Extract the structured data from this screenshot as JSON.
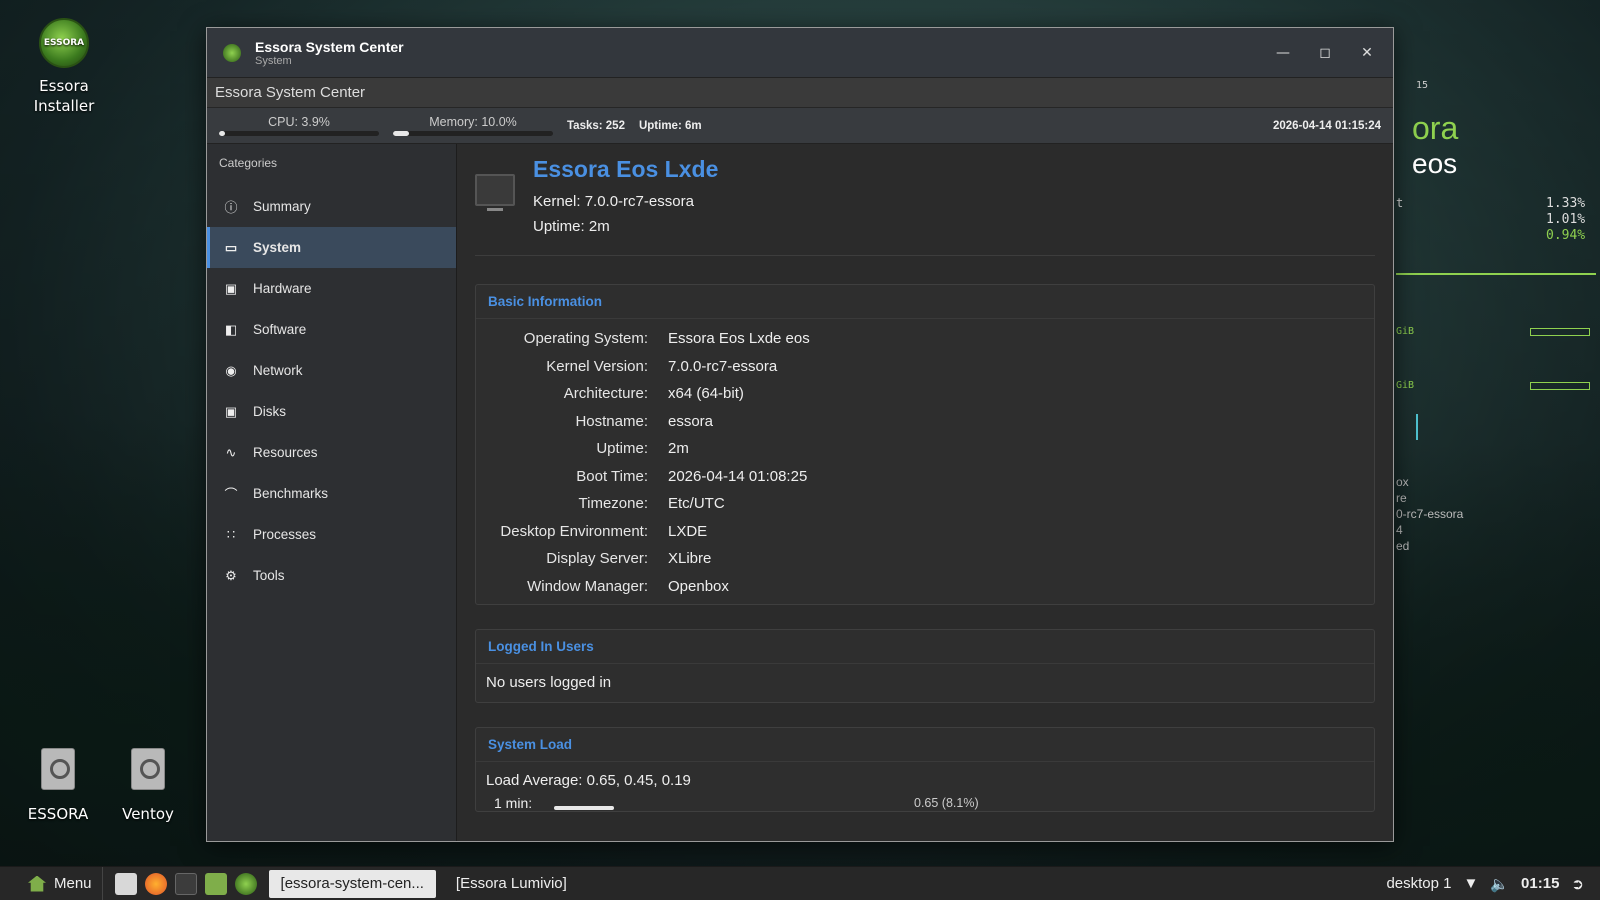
{
  "desktop": {
    "icons": [
      {
        "label_line1": "Essora",
        "label_line2": "Installer"
      },
      {
        "label": "ESSORA"
      },
      {
        "label": "Ventoy"
      }
    ],
    "conky": {
      "brand": "ora",
      "edition": "eos",
      "loads": [
        "1.33%",
        "1.01%",
        "0.94%"
      ],
      "gib1": "GiB",
      "gib2": "GiB",
      "lines": [
        "ox",
        "re",
        "0-rc7-essora",
        "4",
        "ed"
      ],
      "tiny": "15",
      "t_label": "t"
    }
  },
  "window": {
    "title": "Essora System Center",
    "subtitle": "System",
    "app_header": "Essora System Center",
    "status": {
      "cpu_label": "CPU: 3.9%",
      "cpu_fraction": 0.039,
      "mem_label": "Memory: 10.0%",
      "mem_fraction": 0.1,
      "tasks": "Tasks: 252",
      "uptime": "Uptime: 6m",
      "clock": "2026-04-14 01:15:24"
    },
    "sidebar": {
      "heading": "Categories",
      "items": [
        {
          "label": "Summary",
          "icon": "info-icon"
        },
        {
          "label": "System",
          "icon": "monitor-icon"
        },
        {
          "label": "Hardware",
          "icon": "chip-icon"
        },
        {
          "label": "Software",
          "icon": "software-icon"
        },
        {
          "label": "Network",
          "icon": "globe-icon"
        },
        {
          "label": "Disks",
          "icon": "disk-icon"
        },
        {
          "label": "Resources",
          "icon": "pulse-icon"
        },
        {
          "label": "Benchmarks",
          "icon": "speedometer-icon"
        },
        {
          "label": "Processes",
          "icon": "processes-icon"
        },
        {
          "label": "Tools",
          "icon": "gear-icon"
        }
      ]
    },
    "hero": {
      "name": "Essora Eos Lxde",
      "kernel": "Kernel: 7.0.0-rc7-essora",
      "uptime": "Uptime: 2m"
    },
    "basic": {
      "title": "Basic Information",
      "rows": [
        {
          "k": "Operating System:",
          "v": "Essora Eos Lxde eos"
        },
        {
          "k": "Kernel Version:",
          "v": "7.0.0-rc7-essora"
        },
        {
          "k": "Architecture:",
          "v": "x64 (64-bit)"
        },
        {
          "k": "Hostname:",
          "v": "essora"
        },
        {
          "k": "Uptime:",
          "v": "2m"
        },
        {
          "k": "Boot Time:",
          "v": "2026-04-14 01:08:25"
        },
        {
          "k": "Timezone:",
          "v": "Etc/UTC"
        },
        {
          "k": "Desktop Environment:",
          "v": "LXDE"
        },
        {
          "k": "Display Server:",
          "v": "XLibre"
        },
        {
          "k": "Window Manager:",
          "v": "Openbox"
        }
      ]
    },
    "users": {
      "title": "Logged In Users",
      "text": "No users logged in"
    },
    "load": {
      "title": "System Load",
      "average": "Load Average: 0.65, 0.45, 0.19",
      "one_min_label": "1 min:",
      "one_min_value": "0.65 (8.1%)"
    }
  },
  "taskbar": {
    "menu": "Menu",
    "tasks": [
      "[essora-system-cen...",
      "[Essora Lumivio]"
    ],
    "desktop": "desktop 1",
    "time": "01:15"
  }
}
